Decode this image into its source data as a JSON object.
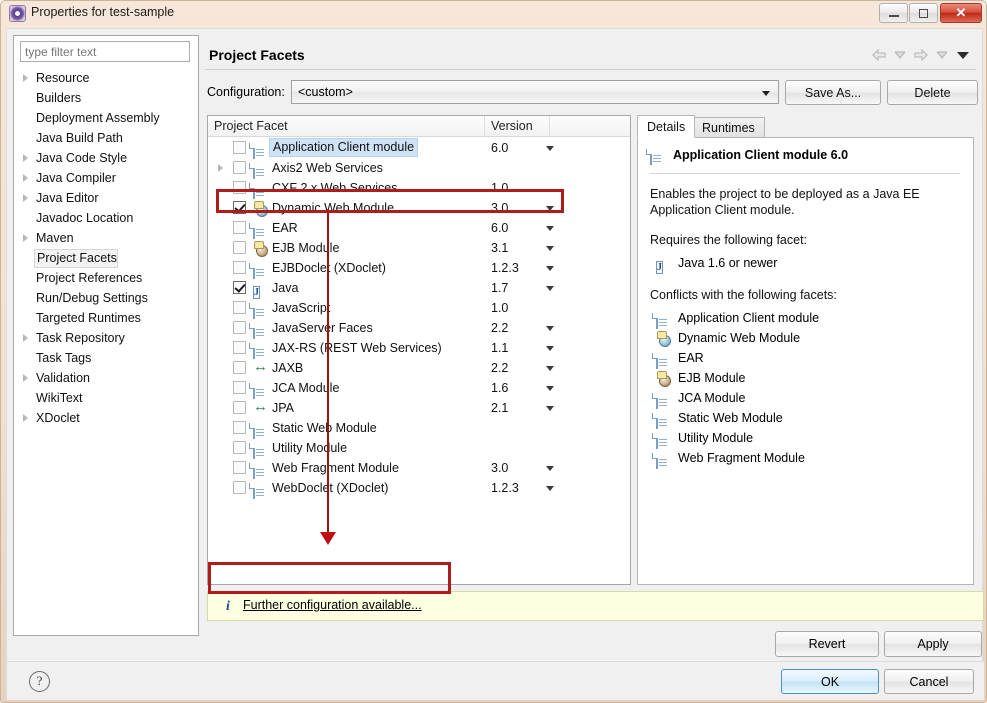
{
  "window": {
    "title": "Properties for test-sample",
    "icon": "eclipse-properties-icon",
    "buttons": {
      "minimize": "minimize-icon",
      "maximize": "maximize-icon",
      "close": "✕"
    }
  },
  "sidebar": {
    "filter_placeholder": "type filter text",
    "filter_value": "",
    "selected": "Project Facets",
    "items": [
      {
        "label": "Resource",
        "expandable": true
      },
      {
        "label": "Builders",
        "expandable": false
      },
      {
        "label": "Deployment Assembly",
        "expandable": false
      },
      {
        "label": "Java Build Path",
        "expandable": false
      },
      {
        "label": "Java Code Style",
        "expandable": true
      },
      {
        "label": "Java Compiler",
        "expandable": true
      },
      {
        "label": "Java Editor",
        "expandable": true
      },
      {
        "label": "Javadoc Location",
        "expandable": false
      },
      {
        "label": "Maven",
        "expandable": true
      },
      {
        "label": "Project Facets",
        "expandable": false
      },
      {
        "label": "Project References",
        "expandable": false
      },
      {
        "label": "Run/Debug Settings",
        "expandable": false
      },
      {
        "label": "Targeted Runtimes",
        "expandable": false
      },
      {
        "label": "Task Repository",
        "expandable": true
      },
      {
        "label": "Task Tags",
        "expandable": false
      },
      {
        "label": "Validation",
        "expandable": true
      },
      {
        "label": "WikiText",
        "expandable": false
      },
      {
        "label": "XDoclet",
        "expandable": true
      }
    ]
  },
  "page": {
    "title": "Project Facets",
    "nav_icons": [
      "back-icon",
      "back-dropdown-icon",
      "forward-icon",
      "forward-dropdown-icon",
      "view-menu-icon"
    ]
  },
  "configuration": {
    "label": "Configuration:",
    "value": "<custom>",
    "save_as_label": "Save As...",
    "delete_label": "Delete"
  },
  "facet_table": {
    "columns": [
      "Project Facet",
      "Version"
    ],
    "rows": [
      {
        "name": "Application Client module",
        "version": "6.0",
        "checked": false,
        "expandable": false,
        "icon": "doc-icon",
        "selected": true,
        "has_dropdown": true
      },
      {
        "name": "Axis2 Web Services",
        "version": "",
        "checked": false,
        "expandable": true,
        "icon": "doc-icon",
        "selected": false,
        "has_dropdown": false
      },
      {
        "name": "CXF 2.x Web Services",
        "version": "1.0",
        "checked": false,
        "expandable": false,
        "icon": "doc-icon",
        "selected": false,
        "has_dropdown": false
      },
      {
        "name": "Dynamic Web Module",
        "version": "3.0",
        "checked": true,
        "expandable": false,
        "icon": "web-icon",
        "selected": false,
        "has_dropdown": true
      },
      {
        "name": "EAR",
        "version": "6.0",
        "checked": false,
        "expandable": false,
        "icon": "doc-icon",
        "selected": false,
        "has_dropdown": true
      },
      {
        "name": "EJB Module",
        "version": "3.1",
        "checked": false,
        "expandable": false,
        "icon": "ejb-icon",
        "selected": false,
        "has_dropdown": true
      },
      {
        "name": "EJBDoclet (XDoclet)",
        "version": "1.2.3",
        "checked": false,
        "expandable": false,
        "icon": "doc-icon",
        "selected": false,
        "has_dropdown": true
      },
      {
        "name": "Java",
        "version": "1.7",
        "checked": true,
        "expandable": false,
        "icon": "java-icon",
        "selected": false,
        "has_dropdown": true
      },
      {
        "name": "JavaScript",
        "version": "1.0",
        "checked": false,
        "expandable": false,
        "icon": "doc-icon",
        "selected": false,
        "has_dropdown": false
      },
      {
        "name": "JavaServer Faces",
        "version": "2.2",
        "checked": false,
        "expandable": false,
        "icon": "doc-icon",
        "selected": false,
        "has_dropdown": true
      },
      {
        "name": "JAX-RS (REST Web Services)",
        "version": "1.1",
        "checked": false,
        "expandable": false,
        "icon": "doc-icon",
        "selected": false,
        "has_dropdown": true
      },
      {
        "name": "JAXB",
        "version": "2.2",
        "checked": false,
        "expandable": false,
        "icon": "arrows-icon",
        "selected": false,
        "has_dropdown": true
      },
      {
        "name": "JCA Module",
        "version": "1.6",
        "checked": false,
        "expandable": false,
        "icon": "doc-icon",
        "selected": false,
        "has_dropdown": true
      },
      {
        "name": "JPA",
        "version": "2.1",
        "checked": false,
        "expandable": false,
        "icon": "arrows-icon",
        "selected": false,
        "has_dropdown": true
      },
      {
        "name": "Static Web Module",
        "version": "",
        "checked": false,
        "expandable": false,
        "icon": "doc-icon",
        "selected": false,
        "has_dropdown": false
      },
      {
        "name": "Utility Module",
        "version": "",
        "checked": false,
        "expandable": false,
        "icon": "doc-icon",
        "selected": false,
        "has_dropdown": false
      },
      {
        "name": "Web Fragment Module",
        "version": "3.0",
        "checked": false,
        "expandable": false,
        "icon": "doc-icon",
        "selected": false,
        "has_dropdown": true
      },
      {
        "name": "WebDoclet (XDoclet)",
        "version": "1.2.3",
        "checked": false,
        "expandable": false,
        "icon": "doc-icon",
        "selected": false,
        "has_dropdown": true
      }
    ]
  },
  "details": {
    "tabs": [
      {
        "label": "Details",
        "active": true
      },
      {
        "label": "Runtimes",
        "active": false
      }
    ],
    "heading": "Application Client module 6.0",
    "heading_icon": "doc-icon",
    "description": "Enables the project to be deployed as a Java EE Application Client module.",
    "requires_label": "Requires the following facet:",
    "requires": [
      {
        "label": "Java 1.6 or newer",
        "icon": "java-icon"
      }
    ],
    "conflicts_label": "Conflicts with the following facets:",
    "conflicts": [
      {
        "label": "Application Client module",
        "icon": "doc-icon"
      },
      {
        "label": "Dynamic Web Module",
        "icon": "web-icon"
      },
      {
        "label": "EAR",
        "icon": "doc-icon"
      },
      {
        "label": "EJB Module",
        "icon": "ejb-icon"
      },
      {
        "label": "JCA Module",
        "icon": "doc-icon"
      },
      {
        "label": "Static Web Module",
        "icon": "doc-icon"
      },
      {
        "label": "Utility Module",
        "icon": "doc-icon"
      },
      {
        "label": "Web Fragment Module",
        "icon": "doc-icon"
      }
    ]
  },
  "notice": {
    "icon": "info-icon",
    "icon_glyph": "i",
    "link_text": "Further configuration available..."
  },
  "actions": {
    "revert": "Revert",
    "apply": "Apply",
    "ok": "OK",
    "cancel": "Cancel",
    "help": "?"
  },
  "annotations": {
    "highlight_color": "#b01c1c",
    "arrow_color": "#c01111",
    "boxes": [
      "dynamic-web-module-row",
      "further-configuration-notice"
    ]
  }
}
